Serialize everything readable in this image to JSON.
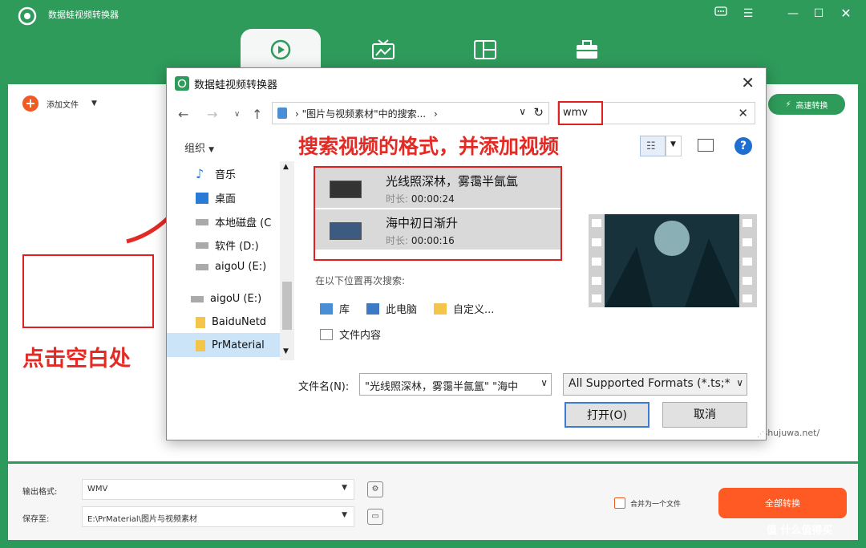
{
  "app": {
    "title": "数据蛙视频转换器"
  },
  "colors": {
    "brand_green": "#2e9b5b",
    "accent_orange": "#ff5a23",
    "annotation_red": "#e42a24"
  },
  "toolbar": {
    "add_file_label": "添加文件",
    "speed_convert_label": "高速转换"
  },
  "tabs": [
    {
      "icon": "convert-icon",
      "active": true
    },
    {
      "icon": "tv-icon",
      "active": false
    },
    {
      "icon": "layout-icon",
      "active": false
    },
    {
      "icon": "toolbox-icon",
      "active": false
    }
  ],
  "annotations": {
    "click_blank": "点击空白处",
    "search_hint": "搜索视频的格式，并添加视频"
  },
  "bottom": {
    "output_format_label": "输出格式:",
    "output_format_value": "WMV",
    "save_to_label": "保存至:",
    "save_to_value": "E:\\PrMaterial\\图片与视频素材",
    "merge_label": "合并为一个文件",
    "convert_all_label": "全部转换"
  },
  "dialog": {
    "title": "数据蛙视频转换器",
    "address": "\"图片与视频素材\"中的搜索...",
    "search_value": "wmv",
    "organize_label": "组织",
    "sidebar": [
      {
        "label": "音乐",
        "icon": "music-icon"
      },
      {
        "label": "桌面",
        "icon": "desktop-icon"
      },
      {
        "label": "本地磁盘 (C",
        "icon": "drive-icon"
      },
      {
        "label": "软件 (D:)",
        "icon": "drive-icon"
      },
      {
        "label": "aigoU (E:)",
        "icon": "drive-icon"
      },
      {
        "label": "aigoU (E:)",
        "icon": "usb-drive-icon"
      },
      {
        "label": "BaiduNetd",
        "icon": "folder-icon"
      },
      {
        "label": "PrMaterial",
        "icon": "folder-icon"
      }
    ],
    "files": [
      {
        "name": "光线照深林，雾霭半氤氲",
        "duration_label": "时长:",
        "duration": "00:00:24"
      },
      {
        "name": "海中初日渐升",
        "duration_label": "时长:",
        "duration": "00:00:16"
      }
    ],
    "search_again_label": "在以下位置再次搜索:",
    "locations": [
      {
        "label": "库",
        "icon": "library-icon"
      },
      {
        "label": "此电脑",
        "icon": "computer-icon"
      },
      {
        "label": "自定义...",
        "icon": "custom-folder-icon"
      },
      {
        "label": "文件内容",
        "icon": "file-content-icon"
      }
    ],
    "filename_label": "文件名(N):",
    "filename_value": "\"光线照深林，雾霭半氤氲\" \"海中",
    "format_value": "All Supported Formats (*.ts;*",
    "open_label": "打开(O)",
    "cancel_label": "取消"
  },
  "watermark": {
    "site": "w.shujuwa.net/",
    "brand": "什么值得买"
  }
}
